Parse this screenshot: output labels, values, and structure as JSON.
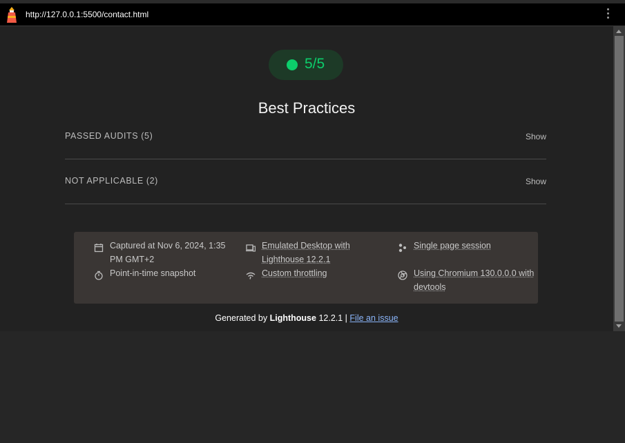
{
  "browser": {
    "url": "http://127.0.0.1:5500/contact.html"
  },
  "gauge": {
    "score": "5/5",
    "color": "#0cce6b"
  },
  "category": {
    "title": "Best Practices"
  },
  "groups": [
    {
      "label": "PASSED AUDITS (5)",
      "toggle": "Show"
    },
    {
      "label": "NOT APPLICABLE (2)",
      "toggle": "Show"
    }
  ],
  "runtime": {
    "captured": "Captured at Nov 6, 2024, 1:35 PM GMT+2",
    "snapshot": "Point-in-time snapshot",
    "emulated": "Emulated Desktop with Lighthouse 12.2.1",
    "throttling": "Custom throttling",
    "session": "Single page session",
    "chromium": "Using Chromium 130.0.0.0 with devtools"
  },
  "footer": {
    "prefix": "Generated by",
    "brand": "Lighthouse",
    "version": "12.2.1 |",
    "issue_link": "File an issue"
  },
  "icons": [
    "lighthouse-logo-icon",
    "kebab-menu-icon",
    "calendar-icon",
    "stopwatch-icon",
    "devices-icon",
    "wifi-icon",
    "users-icon",
    "chrome-icon"
  ]
}
